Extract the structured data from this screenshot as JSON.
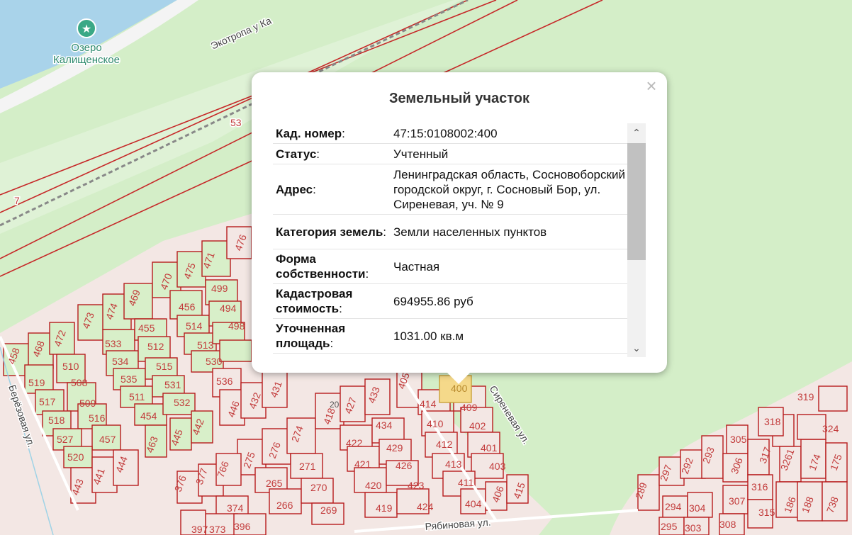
{
  "map": {
    "lake_name_line1": "Озеро",
    "lake_name_line2": "Калищенское",
    "trail_label": "Экотропа у Ка",
    "label_53": "53",
    "label_7": "7",
    "streets": {
      "berezovaya": "Берёзовая ул.",
      "sirenevaya": "Сиреневая ул.",
      "ryabinovaya": "Рябиновая ул."
    },
    "selected_plot": "400"
  },
  "popup": {
    "title": "Земельный участок",
    "close_glyph": "×",
    "rows": [
      {
        "key": "Кад. номер",
        "colon": ":",
        "value": "47:15:0108002:400"
      },
      {
        "key": "Статус",
        "colon": ":",
        "value": "Учтенный"
      },
      {
        "key": "Адрес",
        "colon": ":",
        "value": "Ленинградская область, Сосновоборский городской округ, г. Сосновый Бор, ул. Сиреневая, уч. № 9"
      },
      {
        "key": "Категория земель",
        "colon": ":",
        "value": "Земли населенных пунктов"
      },
      {
        "key": "Форма собственности",
        "colon": ":",
        "value": "Частная"
      },
      {
        "key": "Кадастровая стоимость",
        "colon": ":",
        "value": "694955.86 руб"
      },
      {
        "key": "Уточненная площадь",
        "colon": ":",
        "value": "1031.00 кв.м"
      }
    ],
    "scroll_up_icon": "chevron-up-icon",
    "scroll_down_icon": "chevron-down-icon"
  },
  "colors": {
    "water": "#a9d3ea",
    "grass": "#d4eec8",
    "plot_border": "#b71c1c",
    "selected_plot": "#f5d98a",
    "poi": "#3aa886"
  }
}
